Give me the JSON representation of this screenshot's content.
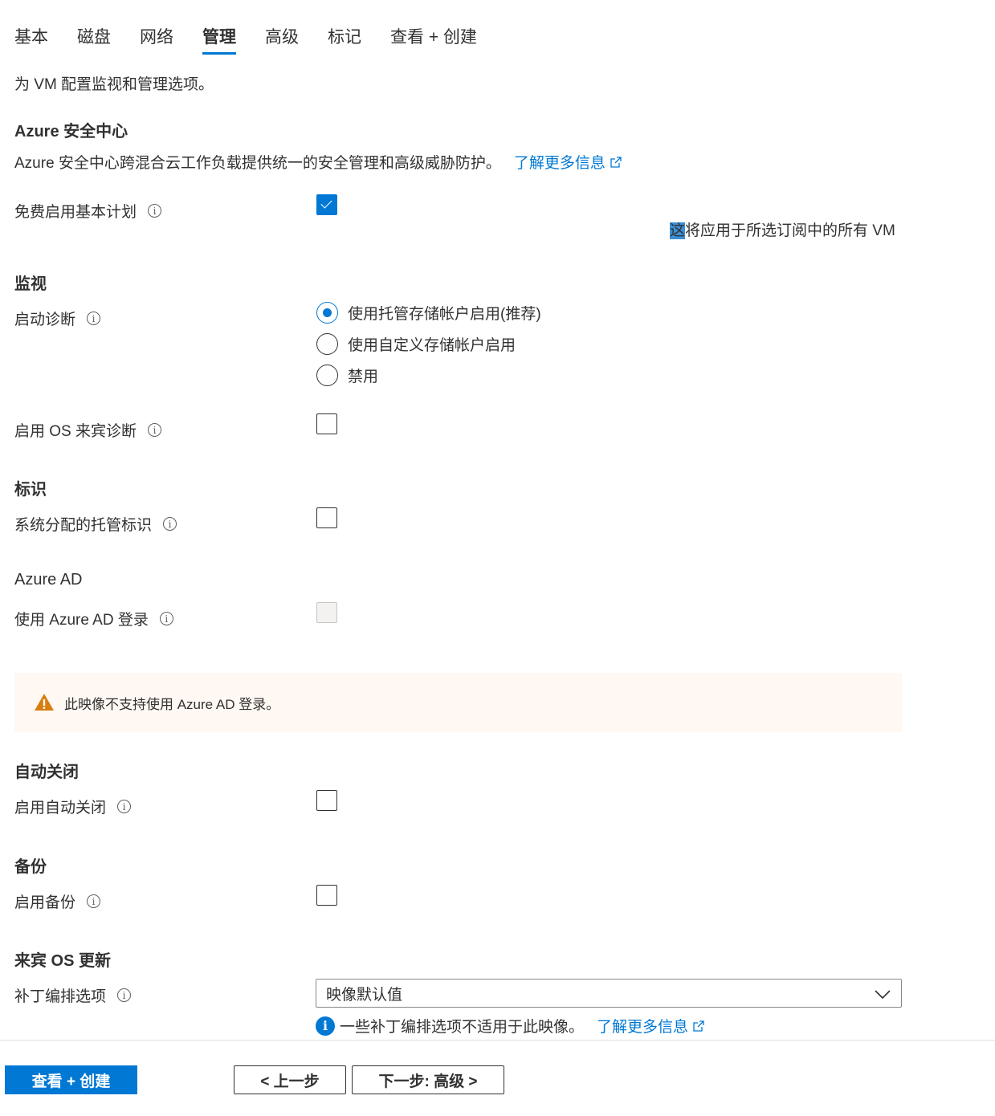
{
  "tabs": [
    {
      "label": "基本"
    },
    {
      "label": "磁盘"
    },
    {
      "label": "网络"
    },
    {
      "label": "管理"
    },
    {
      "label": "高级"
    },
    {
      "label": "标记"
    },
    {
      "label": "查看 + 创建"
    }
  ],
  "active_tab": "管理",
  "page_description": "为 VM 配置监视和管理选项。",
  "security_center": {
    "title": "Azure 安全中心",
    "description": "Azure 安全中心跨混合云工作负载提供统一的安全管理和高级威胁防护。",
    "learn_more": "了解更多信息",
    "basic_plan_label": "免费启用基本计划",
    "basic_plan_checked": true,
    "note_highlight": "这",
    "note_rest": "将应用于所选订阅中的所有 VM"
  },
  "monitoring": {
    "title": "监视",
    "boot_diag_label": "启动诊断",
    "options": [
      {
        "label": "使用托管存储帐户启用(推荐)",
        "selected": true
      },
      {
        "label": "使用自定义存储帐户启用",
        "selected": false
      },
      {
        "label": "禁用",
        "selected": false
      }
    ],
    "os_guest_diag_label": "启用 OS 来宾诊断",
    "os_guest_diag_checked": false
  },
  "identity": {
    "title": "标识",
    "managed_identity_label": "系统分配的托管标识",
    "managed_identity_checked": false
  },
  "azure_ad": {
    "title": "Azure AD",
    "login_label": "使用 Azure AD 登录",
    "login_disabled": true,
    "warning": "此映像不支持使用 Azure AD 登录。"
  },
  "auto_shutdown": {
    "title": "自动关闭",
    "label": "启用自动关闭",
    "checked": false
  },
  "backup": {
    "title": "备份",
    "label": "启用备份",
    "checked": false
  },
  "guest_os_update": {
    "title": "来宾 OS 更新",
    "patch_label": "补丁编排选项",
    "patch_value": "映像默认值",
    "info_text": "一些补丁编排选项不适用于此映像。",
    "learn_more": "了解更多信息"
  },
  "footer": {
    "review_create": "查看 + 创建",
    "previous": "< 上一步",
    "next": "下一步: 高级 >"
  },
  "colors": {
    "accent": "#0078d4",
    "warning": "#d67f0f",
    "warning_bg": "#fff8f3"
  },
  "icons": [
    "info-icon",
    "external-link-icon",
    "warning-icon",
    "chevron-down-icon",
    "checkmark-icon"
  ]
}
